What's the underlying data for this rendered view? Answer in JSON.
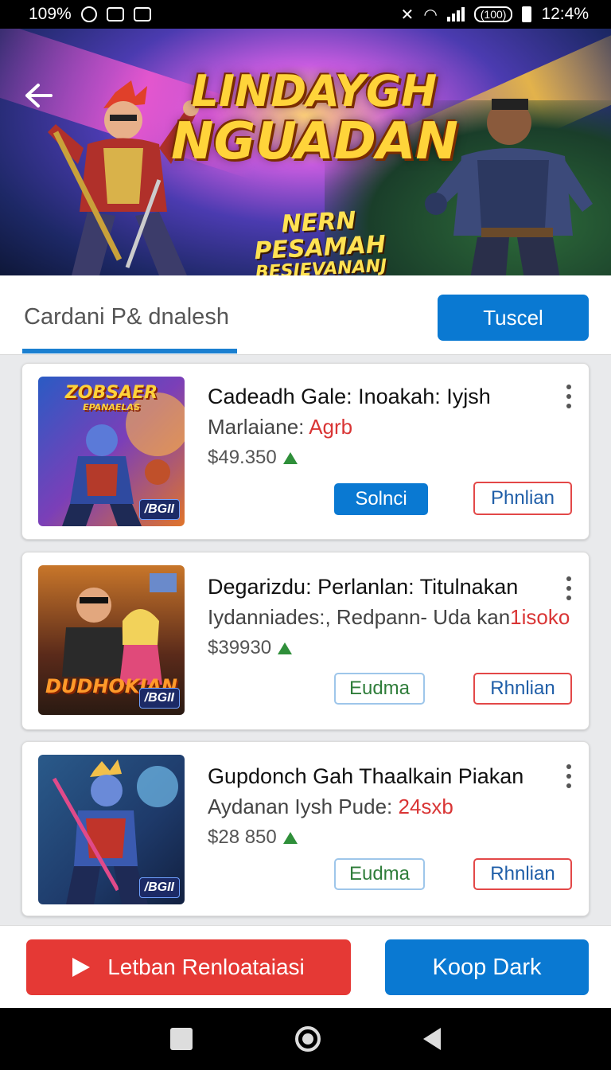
{
  "status_bar": {
    "left_text": "109%",
    "time": "12:4%",
    "pill_text": "(100)"
  },
  "banner": {
    "title_line1": "LINDAYGH",
    "title_line2": "NGUADAN",
    "subtitle_line1": "NERN PESAMAH",
    "subtitle_line2": "BESIEVANANJ"
  },
  "tab": {
    "label": "Cardani P& dnalesh",
    "action_label": "Tuscel"
  },
  "cards": [
    {
      "thumb_title": "ZOBSAER",
      "thumb_subtitle": "EPANAELAS",
      "thumb_badge": "/BGII",
      "title": "Cadeadh Gale: Inoakah: Iyjsh",
      "subtitle": "Marlaiane: ",
      "subtitle_accent": "Agrb",
      "price": "$49.350",
      "button_primary": "Solnci",
      "button_secondary": "Phnlian"
    },
    {
      "thumb_title": "DUDHOKIAN",
      "thumb_subtitle": "",
      "thumb_badge": "/BGII",
      "title": "Degarizdu: Perlanlan: Titulnakan",
      "subtitle": "Iydanniades:, Redpann- Uda kan",
      "subtitle_accent": "1isoko",
      "price": "$39930",
      "button_primary": "Eudma",
      "button_secondary": "Rhnlian"
    },
    {
      "thumb_title": "",
      "thumb_subtitle": "",
      "thumb_badge": "/BGII",
      "title": "Gupdonch Gah Thaalkain Piakan",
      "subtitle": "Aydanan Iysh Pude: ",
      "subtitle_accent": "24sxb",
      "price": "$28 850",
      "button_primary": "Eudma",
      "button_secondary": "Rhnlian"
    }
  ],
  "bottom": {
    "red_button": "Letban Renloataiasi",
    "blue_button": "Koop Dark"
  },
  "colors": {
    "accent_blue": "#0a79d2",
    "accent_red": "#e53935",
    "up_green": "#2f8f3a"
  },
  "icons": [
    "back-arrow-icon",
    "more-vert-icon",
    "trend-up-icon",
    "play-icon",
    "nav-recents-icon",
    "nav-home-icon",
    "nav-back-icon"
  ]
}
